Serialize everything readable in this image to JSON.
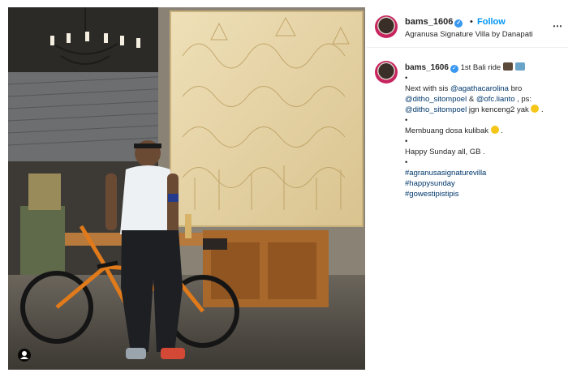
{
  "header": {
    "username": "bams_1606",
    "separator": "•",
    "follow_label": "Follow",
    "location": "Agranusa Signature Villa by Danapati",
    "more_icon": "⋯"
  },
  "caption": {
    "username": "bams_1606",
    "title_text": "1st Bali ride",
    "bullet": "•",
    "line1_prefix": "Next with sis ",
    "mention1": "@agathacarolina",
    "line1_mid": " bro",
    "mention2": "@ditho_sitompoel",
    "amp": " & ",
    "mention3": "@ofc.lianto",
    "ps": " , ps:",
    "mention4": "@ditho_sitompoel",
    "line2_suffix": " jgn kenceng2 yak",
    "dot_end": " .",
    "membuang": "Membuang dosa kulibak",
    "happy": "Happy Sunday all, GB .",
    "hashtag1": "#agranusasignaturevilla",
    "hashtag2": "#happysunday",
    "hashtag3": "#gowestipistipis"
  },
  "colors": {
    "follow": "#0095f6",
    "link": "#00376b",
    "verified": "#3897f0",
    "avatar_ring": "#c7235f"
  },
  "icons": [
    "verified-badge-icon",
    "more-options-icon",
    "tagged-user-icon",
    "bicycle-emoji-icon",
    "smile-emoji-icon"
  ]
}
